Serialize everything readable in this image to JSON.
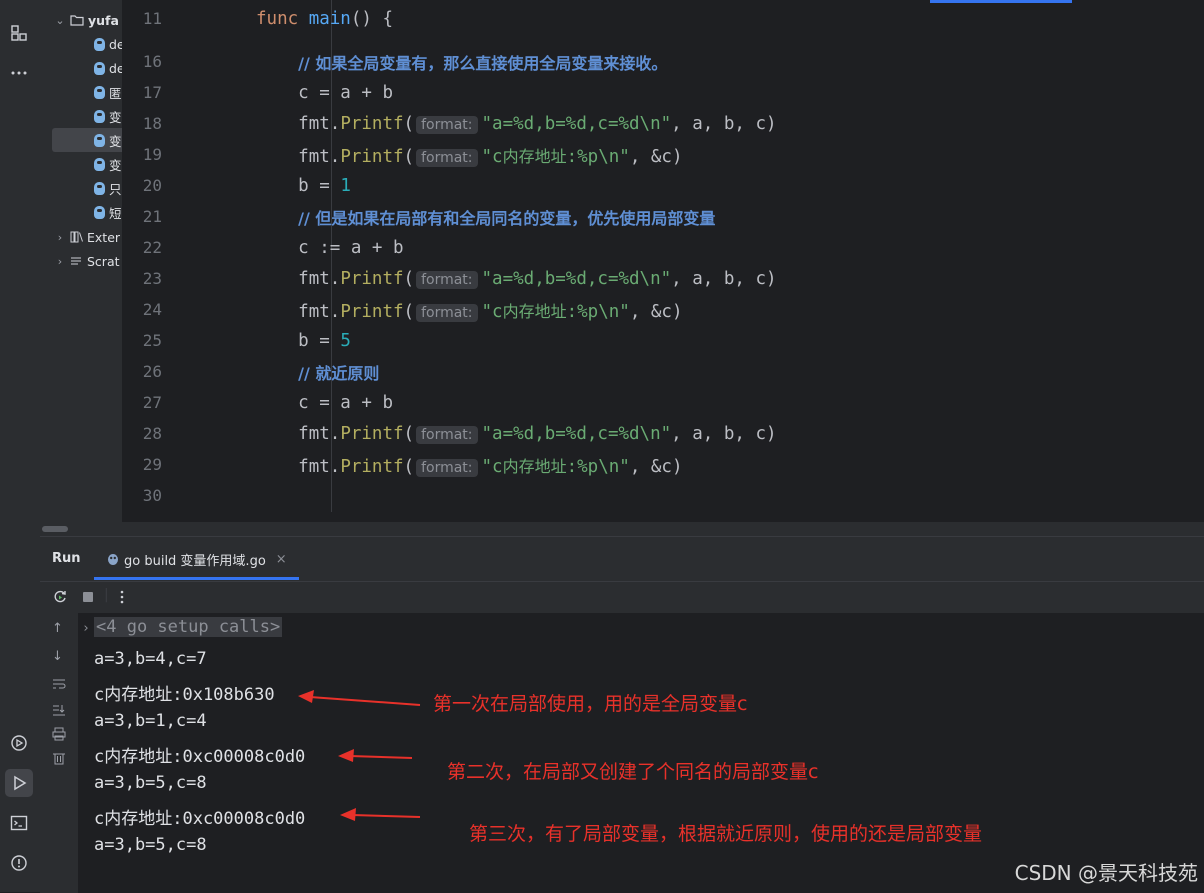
{
  "project_tree": {
    "root_label": "yufa",
    "files": [
      "de",
      "de",
      "匿",
      "变",
      "变",
      "变",
      "只",
      "短"
    ],
    "external_label": "Exter",
    "scratch_label": "Scrat"
  },
  "editor": {
    "lines": [
      {
        "n": "11",
        "parts": [
          [
            "kw",
            "func "
          ],
          [
            "fn",
            "main"
          ],
          [
            "pkg",
            "() {"
          ]
        ]
      },
      {
        "n": "16",
        "parts": [
          [
            "pad",
            "    "
          ],
          [
            "cmt",
            "// 如果全局变量有，那么直接使用全局变量来接收。"
          ]
        ]
      },
      {
        "n": "17",
        "parts": [
          [
            "pad",
            "    "
          ],
          [
            "pkg",
            "c = a + b"
          ]
        ]
      },
      {
        "n": "18",
        "parts": [
          [
            "pad",
            "    "
          ],
          [
            "pkg",
            "fmt."
          ],
          [
            "call",
            "Printf"
          ],
          [
            "pkg",
            "("
          ],
          [
            "hint",
            "format:"
          ],
          [
            "str",
            "\"a=%d,b=%d,c=%d\\n\""
          ],
          [
            "pkg",
            ", a, b, c)"
          ]
        ]
      },
      {
        "n": "19",
        "parts": [
          [
            "pad",
            "    "
          ],
          [
            "pkg",
            "fmt."
          ],
          [
            "call",
            "Printf"
          ],
          [
            "pkg",
            "("
          ],
          [
            "hint",
            "format:"
          ],
          [
            "str",
            "\"c"
          ],
          [
            "strzh",
            "内存地址"
          ],
          [
            "str",
            ":%p\\n\""
          ],
          [
            "pkg",
            ", &c)"
          ]
        ]
      },
      {
        "n": "20",
        "parts": [
          [
            "pad",
            "    "
          ],
          [
            "pkg",
            "b = "
          ],
          [
            "num",
            "1"
          ]
        ]
      },
      {
        "n": "21",
        "parts": [
          [
            "pad",
            "    "
          ],
          [
            "cmt",
            "// 但是如果在局部有和全局同名的变量，优先使用局部变量"
          ]
        ]
      },
      {
        "n": "22",
        "parts": [
          [
            "pad",
            "    "
          ],
          [
            "pkg",
            "c := a + b"
          ]
        ]
      },
      {
        "n": "23",
        "parts": [
          [
            "pad",
            "    "
          ],
          [
            "pkg",
            "fmt."
          ],
          [
            "call",
            "Printf"
          ],
          [
            "pkg",
            "("
          ],
          [
            "hint",
            "format:"
          ],
          [
            "str",
            "\"a=%d,b=%d,c=%d\\n\""
          ],
          [
            "pkg",
            ", a, b, c)"
          ]
        ]
      },
      {
        "n": "24",
        "parts": [
          [
            "pad",
            "    "
          ],
          [
            "pkg",
            "fmt."
          ],
          [
            "call",
            "Printf"
          ],
          [
            "pkg",
            "("
          ],
          [
            "hint",
            "format:"
          ],
          [
            "str",
            "\"c"
          ],
          [
            "strzh",
            "内存地址"
          ],
          [
            "str",
            ":%p\\n\""
          ],
          [
            "pkg",
            ", &c)"
          ]
        ]
      },
      {
        "n": "25",
        "parts": [
          [
            "pad",
            "    "
          ],
          [
            "pkg",
            "b = "
          ],
          [
            "num",
            "5"
          ]
        ]
      },
      {
        "n": "26",
        "parts": [
          [
            "pad",
            "    "
          ],
          [
            "cmt",
            "// 就近原则"
          ]
        ]
      },
      {
        "n": "27",
        "parts": [
          [
            "pad",
            "    "
          ],
          [
            "pkg",
            "c = a + b"
          ]
        ]
      },
      {
        "n": "28",
        "parts": [
          [
            "pad",
            "    "
          ],
          [
            "pkg",
            "fmt."
          ],
          [
            "call",
            "Printf"
          ],
          [
            "pkg",
            "("
          ],
          [
            "hint",
            "format:"
          ],
          [
            "str",
            "\"a=%d,b=%d,c=%d\\n\""
          ],
          [
            "pkg",
            ", a, b, c)"
          ]
        ]
      },
      {
        "n": "29",
        "parts": [
          [
            "pad",
            "    "
          ],
          [
            "pkg",
            "fmt."
          ],
          [
            "call",
            "Printf"
          ],
          [
            "pkg",
            "("
          ],
          [
            "hint",
            "format:"
          ],
          [
            "str",
            "\"c"
          ],
          [
            "strzh",
            "内存地址"
          ],
          [
            "str",
            ":%p\\n\""
          ],
          [
            "pkg",
            ", &c)"
          ]
        ]
      },
      {
        "n": "30",
        "parts": []
      }
    ]
  },
  "run_panel": {
    "title": "Run",
    "tab_label": "go build 变量作用域.go",
    "close_glyph": "×",
    "setup_calls": "<4 go setup calls>",
    "output": [
      "a=3,b=4,c=7",
      "c内存地址:0x108b630",
      "a=3,b=1,c=4",
      "c内存地址:0xc00008c0d0",
      "a=3,b=5,c=8",
      "c内存地址:0xc00008c0d0",
      "a=3,b=5,c=8"
    ]
  },
  "annotations": {
    "first": "第一次在局部使用，用的是全局变量c",
    "second": "第二次，在局部又创建了个同名的局部变量c",
    "third": "第三次，有了局部变量，根据就近原则，使用的还是局部变量",
    "color": "#e8312a"
  },
  "watermark": "CSDN @景天科技苑"
}
